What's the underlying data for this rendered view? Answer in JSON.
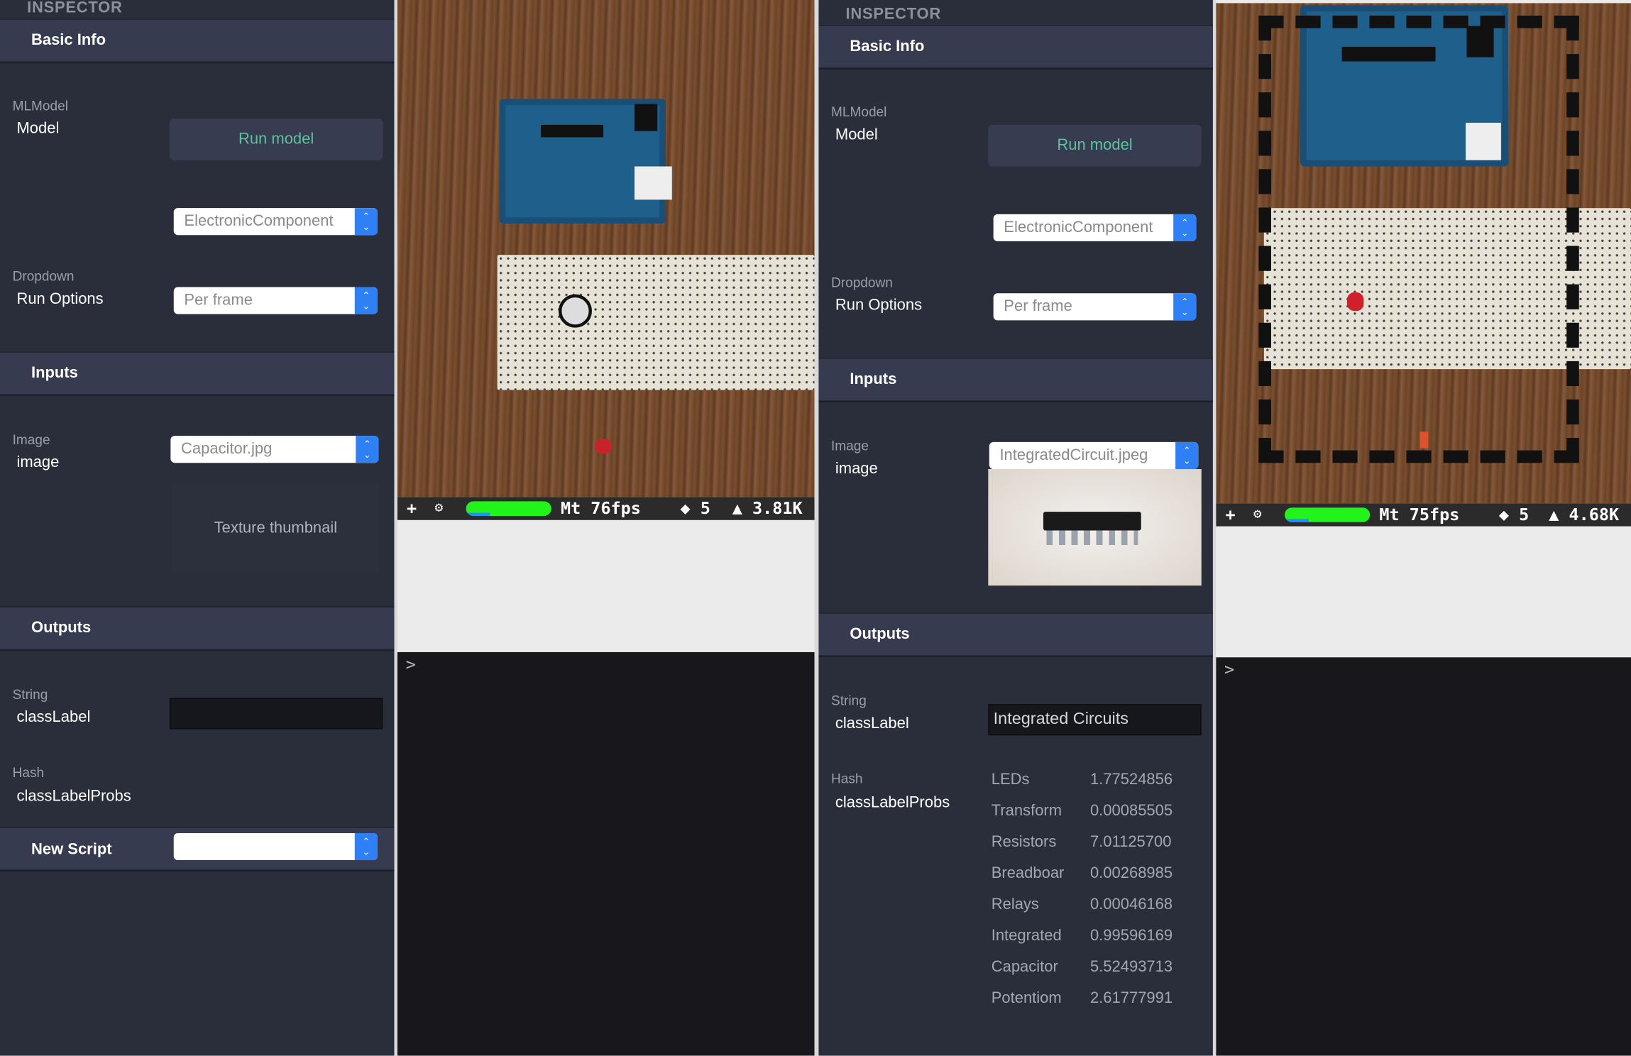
{
  "left_inspector": {
    "title": "INSPECTOR",
    "basic_info": "Basic Info",
    "model_type": "MLModel",
    "model_name": "Model",
    "run_model": "Run model",
    "model_select": "ElectronicComponent",
    "dropdown_type": "Dropdown",
    "dropdown_name": "Run Options",
    "run_options_value": "Per frame",
    "inputs": "Inputs",
    "image_type": "Image",
    "image_name": "image",
    "image_select": "Capacitor.jpg",
    "thumbnail": "Texture thumbnail",
    "outputs": "Outputs",
    "string_type": "String",
    "class_label_name": "classLabel",
    "class_label_value": "",
    "hash_type": "Hash",
    "probs_name": "classLabelProbs",
    "new_script": "New Script",
    "new_script_value": ""
  },
  "left_viewport": {
    "add": "+",
    "gear": "⚙",
    "progress": 0.95,
    "fps": "Mt  76fps",
    "objects": "◆ 5",
    "triangles": "▲ 3.81K",
    "prompt": ">"
  },
  "right_inspector": {
    "title": "INSPECTOR",
    "basic_info": "Basic Info",
    "model_type": "MLModel",
    "model_name": "Model",
    "run_model": "Run model",
    "model_select": "ElectronicComponent",
    "dropdown_type": "Dropdown",
    "dropdown_name": "Run Options",
    "run_options_value": "Per frame",
    "inputs": "Inputs",
    "image_type": "Image",
    "image_name": "image",
    "image_select": "IntegratedCircuit.jpeg",
    "outputs": "Outputs",
    "string_type": "String",
    "class_label_name": "classLabel",
    "class_label_value": "Integrated Circuits",
    "hash_type": "Hash",
    "probs_name": "classLabelProbs",
    "probs": [
      {
        "label": "LEDs",
        "value": "1.77524856"
      },
      {
        "label": "Transform",
        "value": "0.00085505"
      },
      {
        "label": "Resistors",
        "value": "7.01125700"
      },
      {
        "label": "Breadboar",
        "value": "0.00268985"
      },
      {
        "label": "Relays",
        "value": "0.00046168"
      },
      {
        "label": "Integrated",
        "value": "0.99596169"
      },
      {
        "label": "Capacitor",
        "value": "5.52493713"
      },
      {
        "label": "Potentiom",
        "value": "2.61777991"
      }
    ]
  },
  "right_viewport": {
    "add": "+",
    "gear": "⚙",
    "progress": 0.95,
    "fps": "Mt  75fps",
    "objects": "◆ 5",
    "triangles": "▲ 4.68K",
    "prompt": ">"
  },
  "colors": {
    "accent": "#2f80f5",
    "run_button_text": "#5ec29e",
    "fps_bar": "#21f31b",
    "panel_bg": "#2a2e3b",
    "header_bg": "#363b4f"
  }
}
